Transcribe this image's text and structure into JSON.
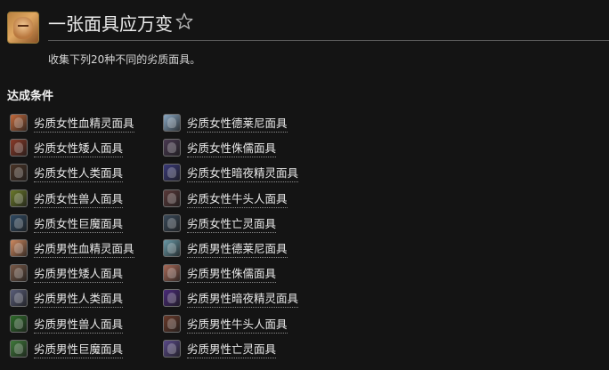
{
  "achievement": {
    "title": "一张面具应万变",
    "description": "收集下列20种不同的劣质面具。"
  },
  "criteria_section": {
    "heading": "达成条件",
    "items": [
      {
        "label": "劣质女性血精灵面具",
        "icon": "blood-elf-female-mask-icon",
        "color": "#c46a3c"
      },
      {
        "label": "劣质女性矮人面具",
        "icon": "dwarf-female-mask-icon",
        "color": "#8a3a28"
      },
      {
        "label": "劣质女性人类面具",
        "icon": "human-female-mask-icon",
        "color": "#4a3426"
      },
      {
        "label": "劣质女性兽人面具",
        "icon": "orc-female-mask-icon",
        "color": "#6b7a2a"
      },
      {
        "label": "劣质女性巨魔面具",
        "icon": "troll-female-mask-icon",
        "color": "#2f4a63"
      },
      {
        "label": "劣质男性血精灵面具",
        "icon": "blood-elf-male-mask-icon",
        "color": "#d08a60"
      },
      {
        "label": "劣质男性矮人面具",
        "icon": "dwarf-male-mask-icon",
        "color": "#7a5a48"
      },
      {
        "label": "劣质男性人类面具",
        "icon": "human-male-mask-icon",
        "color": "#5a5e7a"
      },
      {
        "label": "劣质男性兽人面具",
        "icon": "orc-male-mask-icon",
        "color": "#2e6b2a"
      },
      {
        "label": "劣质男性巨魔面具",
        "icon": "troll-male-mask-icon",
        "color": "#3f7a3a"
      },
      {
        "label": "劣质女性德莱尼面具",
        "icon": "draenei-female-mask-icon",
        "color": "#8aa8c4"
      },
      {
        "label": "劣质女性侏儒面具",
        "icon": "gnome-female-mask-icon",
        "color": "#4a3a52"
      },
      {
        "label": "劣质女性暗夜精灵面具",
        "icon": "night-elf-female-mask-icon",
        "color": "#3a3a7a"
      },
      {
        "label": "劣质女性牛头人面具",
        "icon": "tauren-female-mask-icon",
        "color": "#5a3a3a"
      },
      {
        "label": "劣质女性亡灵面具",
        "icon": "undead-female-mask-icon",
        "color": "#3a4a5a"
      },
      {
        "label": "劣质男性德莱尼面具",
        "icon": "draenei-male-mask-icon",
        "color": "#6a9aa8"
      },
      {
        "label": "劣质男性侏儒面具",
        "icon": "gnome-male-mask-icon",
        "color": "#a86a58"
      },
      {
        "label": "劣质男性暗夜精灵面具",
        "icon": "night-elf-male-mask-icon",
        "color": "#4a2a7a"
      },
      {
        "label": "劣质男性牛头人面具",
        "icon": "tauren-male-mask-icon",
        "color": "#6a3a2a"
      },
      {
        "label": "劣质男性亡灵面具",
        "icon": "undead-male-mask-icon",
        "color": "#5a4a8a"
      }
    ]
  }
}
